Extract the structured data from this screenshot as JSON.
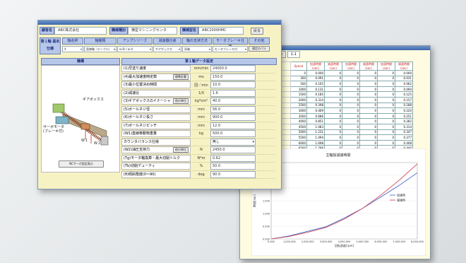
{
  "back_window": {
    "header": {
      "label": "No",
      "value": "1.1"
    },
    "columns": [
      "Speed",
      "加速時間(sec)",
      "減速時間(sec)",
      "加速時間(sec)",
      "減速時間(sec)",
      "加速時間(sec)",
      "減速時間(sec)"
    ],
    "rows": [
      [
        "0",
        "0.000",
        "0",
        "0",
        "0",
        "0",
        "0.000"
      ],
      [
        "300",
        "0.091",
        "0",
        "0",
        "0",
        "0",
        "0.031"
      ],
      [
        "500",
        "0.105",
        "0",
        "0",
        "0",
        "0",
        "0.062"
      ],
      [
        "1000",
        "0.131",
        "0",
        "0",
        "0",
        "0",
        "0.094"
      ],
      [
        "1500",
        "0.185",
        "0",
        "0",
        "0",
        "0",
        "0.125"
      ],
      [
        "2000",
        "0.314",
        "0",
        "0",
        "0",
        "0",
        "0.157"
      ],
      [
        "2500",
        "0.398",
        "0",
        "0",
        "0",
        "0",
        "0.188"
      ],
      [
        "3000",
        "0.469",
        "0",
        "0",
        "0",
        "0",
        "0.220"
      ],
      [
        "3500",
        "0.686",
        "0",
        "0",
        "0",
        "0",
        "0.251"
      ],
      [
        "4000",
        "0.851",
        "0",
        "0",
        "0",
        "0",
        "0.282"
      ],
      [
        "4500",
        "1.083",
        "0",
        "0",
        "0",
        "0",
        "0.314"
      ],
      [
        "5000",
        "1.231",
        "0",
        "0",
        "0",
        "0",
        "0.347"
      ],
      [
        "5500",
        "1.494",
        "0",
        "0",
        "0",
        "0",
        "0.377"
      ],
      [
        "6000",
        "1.698",
        "0",
        "0",
        "0",
        "0",
        "0.408"
      ],
      [
        "6500",
        "1.788",
        "0",
        "0",
        "0",
        "0",
        "0.440"
      ],
      [
        "7000",
        "2.097",
        "0",
        "0",
        "0",
        "0",
        "0.471"
      ],
      [
        "7500",
        "2.387",
        "0",
        "0",
        "0",
        "0",
        "0.502"
      ],
      [
        "8000",
        "2.808",
        "0",
        "0",
        "0",
        "0",
        "0.534"
      ]
    ],
    "chart_data": {
      "type": "line",
      "title": "主軸加減速時間",
      "xlabel": "回転速度[rpm]",
      "ylabel": "時間[sec]",
      "x": [
        0,
        1000,
        2000,
        3000,
        4000,
        5000,
        6000,
        7000,
        8000
      ],
      "series": [
        {
          "name": "加速時",
          "values": [
            0,
            0.12,
            0.3,
            0.48,
            0.82,
            1.2,
            1.65,
            2.1,
            2.6
          ],
          "color": "#3a5fc8"
        },
        {
          "name": "減速時",
          "values": [
            0,
            0.1,
            0.26,
            0.45,
            0.78,
            1.2,
            1.72,
            2.3,
            2.95
          ],
          "color": "#d23a4a"
        }
      ],
      "xlim": [
        0,
        8000
      ],
      "ylim": [
        0,
        3.0
      ]
    }
  },
  "front_window": {
    "row1": {
      "customer_label": "顧客名",
      "customer_value": "ABC株式会社",
      "type_label": "機械種別",
      "type_value": "横型マシニングセンタ",
      "model_label": "機械型名",
      "model_value": "ABC2000HMC",
      "back_button": "戻る"
    },
    "basic_spec_label": "第１軸\n基本仕様",
    "selectors": [
      {
        "label": "軸名称",
        "value": "X"
      },
      {
        "label": "軸種類",
        "value": "直線軸（テーブル）"
      },
      {
        "label": "アンプシリーズ",
        "value": "αi-B / αi-V"
      },
      {
        "label": "減速器仕様",
        "value": "ギアボックス"
      },
      {
        "label": "軸の支持方法",
        "value": "両端"
      },
      {
        "label": "モータブレーキ仕様",
        "value": "モータブレーキ付"
      }
    ],
    "misc_label": "その他",
    "settings_button": "規定のパラ",
    "left_section_title": "機構",
    "right_section_title": "第１軸データ設定",
    "diagram_labels": {
      "gearbox": "ギアボックス",
      "servo": "サーボモータ\n(ブレーキ付)",
      "w1": "W１",
      "w2": "W２"
    },
    "nc_button": "NCサーボ設定表示",
    "params": [
      {
        "name": "(1)早送り速度",
        "unit": "mm/min",
        "value": "24000.0",
        "btn": ""
      },
      {
        "name": "(4)最大加速度時定数",
        "btn": "標準計算",
        "unit": "ms",
        "value": "150.0"
      },
      {
        "name": "(3)最小位置決め時間",
        "btn": "",
        "unit": "回／min",
        "value": "10.0"
      },
      {
        "name": "(2)減速比",
        "btn": "",
        "unit": "1/X",
        "value": "1.6"
      },
      {
        "name": "(3)ギアボックスのイナーシャ",
        "btn": "他の単位",
        "unit": "kg*cm²",
        "value": "40.0"
      },
      {
        "name": "(5)ボールネジ径",
        "btn": "",
        "unit": "mm",
        "value": "56.0"
      },
      {
        "name": "(6)ボールネジ長さ",
        "btn": "",
        "unit": "mm",
        "value": "900.0"
      },
      {
        "name": "(7)ボールネジピッチ",
        "btn": "",
        "unit": "mm",
        "value": "12.0"
      },
      {
        "name": "(W1)直線移動物重量",
        "btn": "",
        "unit": "kg",
        "value": "500.0"
      },
      {
        "name": "カウンタバランス仕様",
        "btn": "",
        "unit": "",
        "value": "無し"
      },
      {
        "name": "(W2)油圧支持力",
        "btn": "他の単位",
        "unit": "N",
        "value": "2450.0"
      },
      {
        "name": "(Tg)モータ軸換算・最大切削トルク",
        "btn": "",
        "unit": "N*m",
        "value": "0.62"
      },
      {
        "name": "(Tb)切削デューティ",
        "btn": "",
        "unit": "%",
        "value": "50.0"
      },
      {
        "name": "(θ)傾斜角度(0〜90)",
        "btn": "",
        "unit": "deg",
        "value": "90.0"
      }
    ]
  }
}
